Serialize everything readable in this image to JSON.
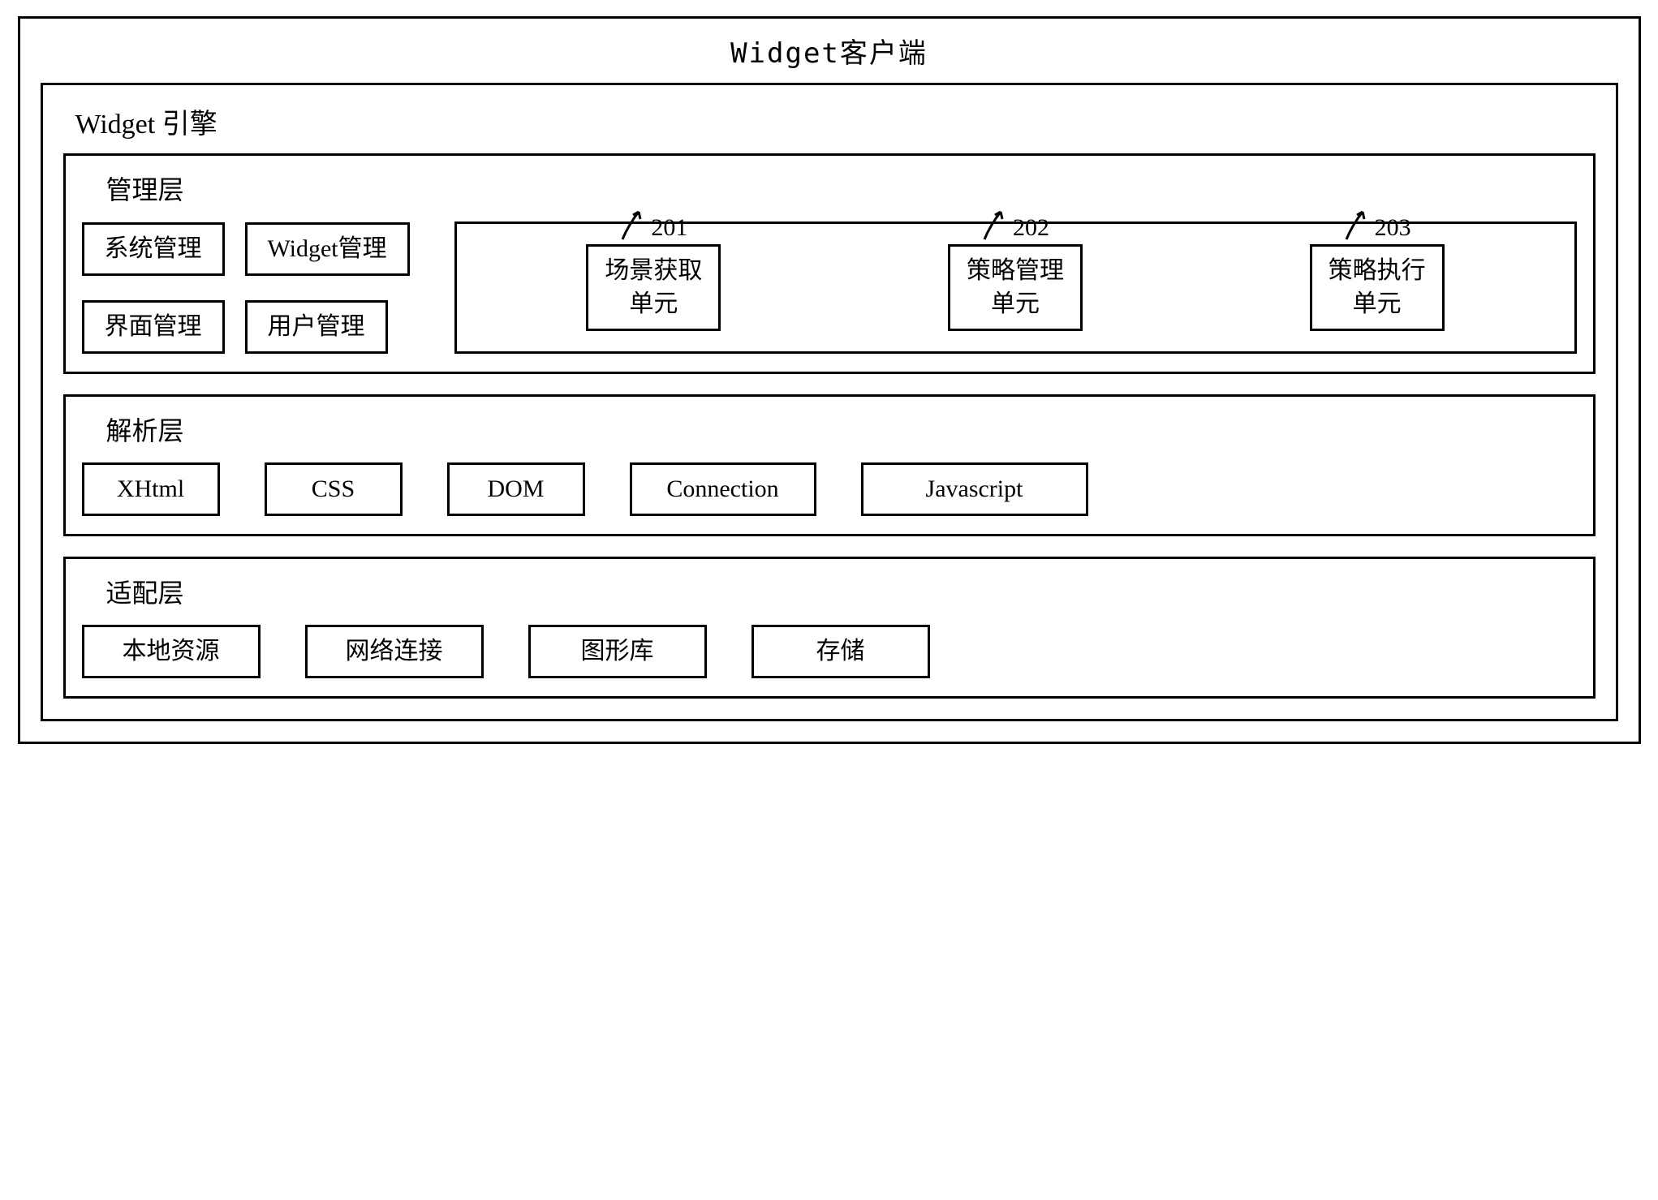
{
  "client": {
    "title": "Widget客户端"
  },
  "engine": {
    "title": "Widget 引擎"
  },
  "management_layer": {
    "title": "管理层",
    "system_management": "系统管理",
    "widget_management": "Widget管理",
    "interface_management": "界面管理",
    "user_management": "用户管理",
    "units": {
      "scene_acquisition": {
        "ref": "201",
        "line1": "场景获取",
        "line2": "单元"
      },
      "policy_management": {
        "ref": "202",
        "line1": "策略管理",
        "line2": "单元"
      },
      "policy_execution": {
        "ref": "203",
        "line1": "策略执行",
        "line2": "单元"
      }
    }
  },
  "parsing_layer": {
    "title": "解析层",
    "xhtml": "XHtml",
    "css": "CSS",
    "dom": "DOM",
    "connection": "Connection",
    "javascript": "Javascript"
  },
  "adaptation_layer": {
    "title": "适配层",
    "local_resources": "本地资源",
    "network_connection": "网络连接",
    "graphics_library": "图形库",
    "storage": "存储"
  }
}
